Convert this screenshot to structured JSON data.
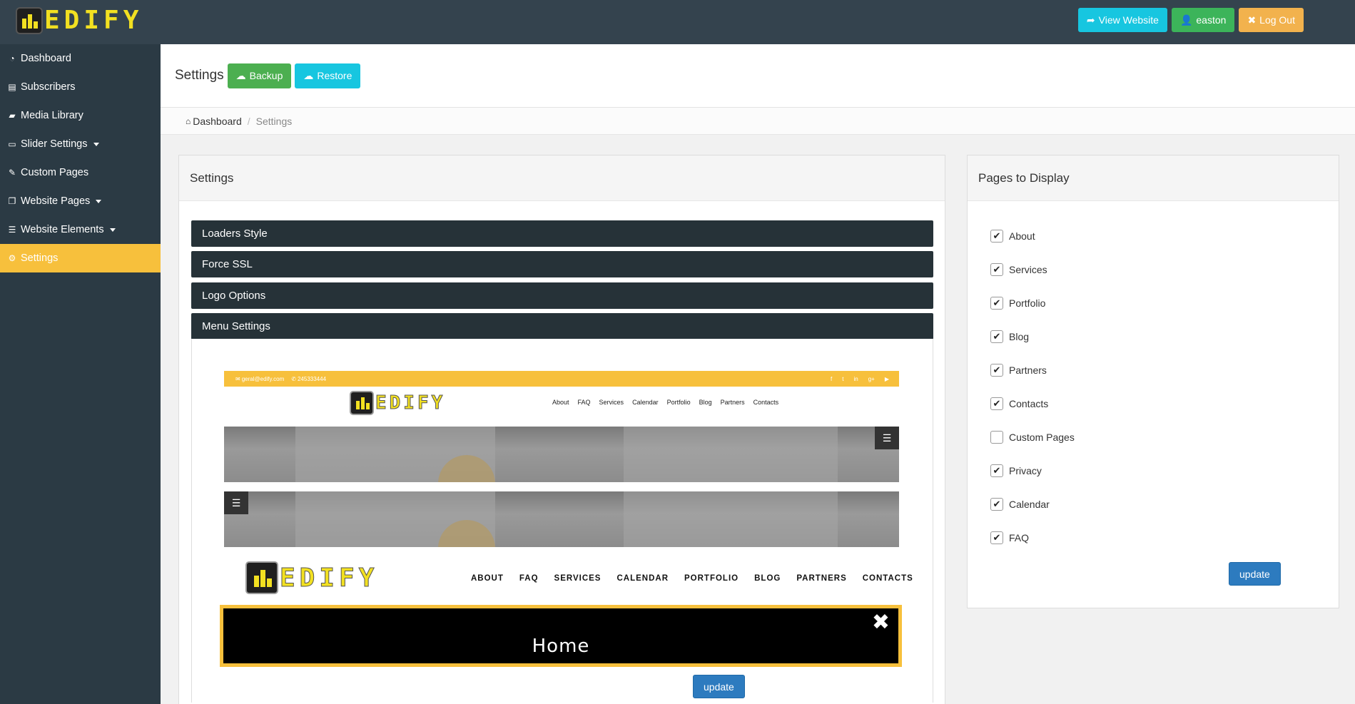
{
  "brand": {
    "name": "EDIFY"
  },
  "topbar": {
    "view_website": "View Website",
    "user": "easton",
    "logout": "Log Out"
  },
  "sidebar": {
    "items": [
      {
        "label": "Dashboard",
        "icon": "dashboard-icon"
      },
      {
        "label": "Subscribers",
        "icon": "newspaper-icon"
      },
      {
        "label": "Media Library",
        "icon": "folder-open-icon"
      },
      {
        "label": "Slider Settings",
        "icon": "desktop-icon",
        "dropdown": true
      },
      {
        "label": "Custom Pages",
        "icon": "edit-icon"
      },
      {
        "label": "Website Pages",
        "icon": "pages-icon",
        "dropdown": true
      },
      {
        "label": "Website Elements",
        "icon": "bars-icon",
        "dropdown": true
      },
      {
        "label": "Settings",
        "icon": "gears-icon",
        "active": true
      }
    ]
  },
  "header": {
    "title": "Settings",
    "backup": "Backup",
    "restore": "Restore"
  },
  "breadcrumb": {
    "home": "Dashboard",
    "current": "Settings"
  },
  "settings_panel": {
    "title": "Settings",
    "sections": [
      "Loaders Style",
      "Force SSL",
      "Logo Options",
      "Menu Settings"
    ],
    "menu_preview": {
      "email": "geral@edify.com",
      "phone": "245333444",
      "small_nav": [
        "About",
        "FAQ",
        "Services",
        "Calendar",
        "Portfolio",
        "Blog",
        "Partners",
        "Contacts"
      ],
      "large_nav": [
        "ABOUT",
        "FAQ",
        "SERVICES",
        "CALENDAR",
        "PORTFOLIO",
        "BLOG",
        "PARTNERS",
        "CONTACTS"
      ],
      "overlay_item": "Home"
    },
    "update": "update"
  },
  "pages_panel": {
    "title": "Pages to Display",
    "pages": [
      {
        "label": "About",
        "checked": true
      },
      {
        "label": "Services",
        "checked": true
      },
      {
        "label": "Portfolio",
        "checked": true
      },
      {
        "label": "Blog",
        "checked": true
      },
      {
        "label": "Partners",
        "checked": true
      },
      {
        "label": "Contacts",
        "checked": true
      },
      {
        "label": "Custom Pages",
        "checked": false
      },
      {
        "label": "Privacy",
        "checked": true
      },
      {
        "label": "Calendar",
        "checked": true
      },
      {
        "label": "FAQ",
        "checked": true
      }
    ],
    "update": "update"
  }
}
